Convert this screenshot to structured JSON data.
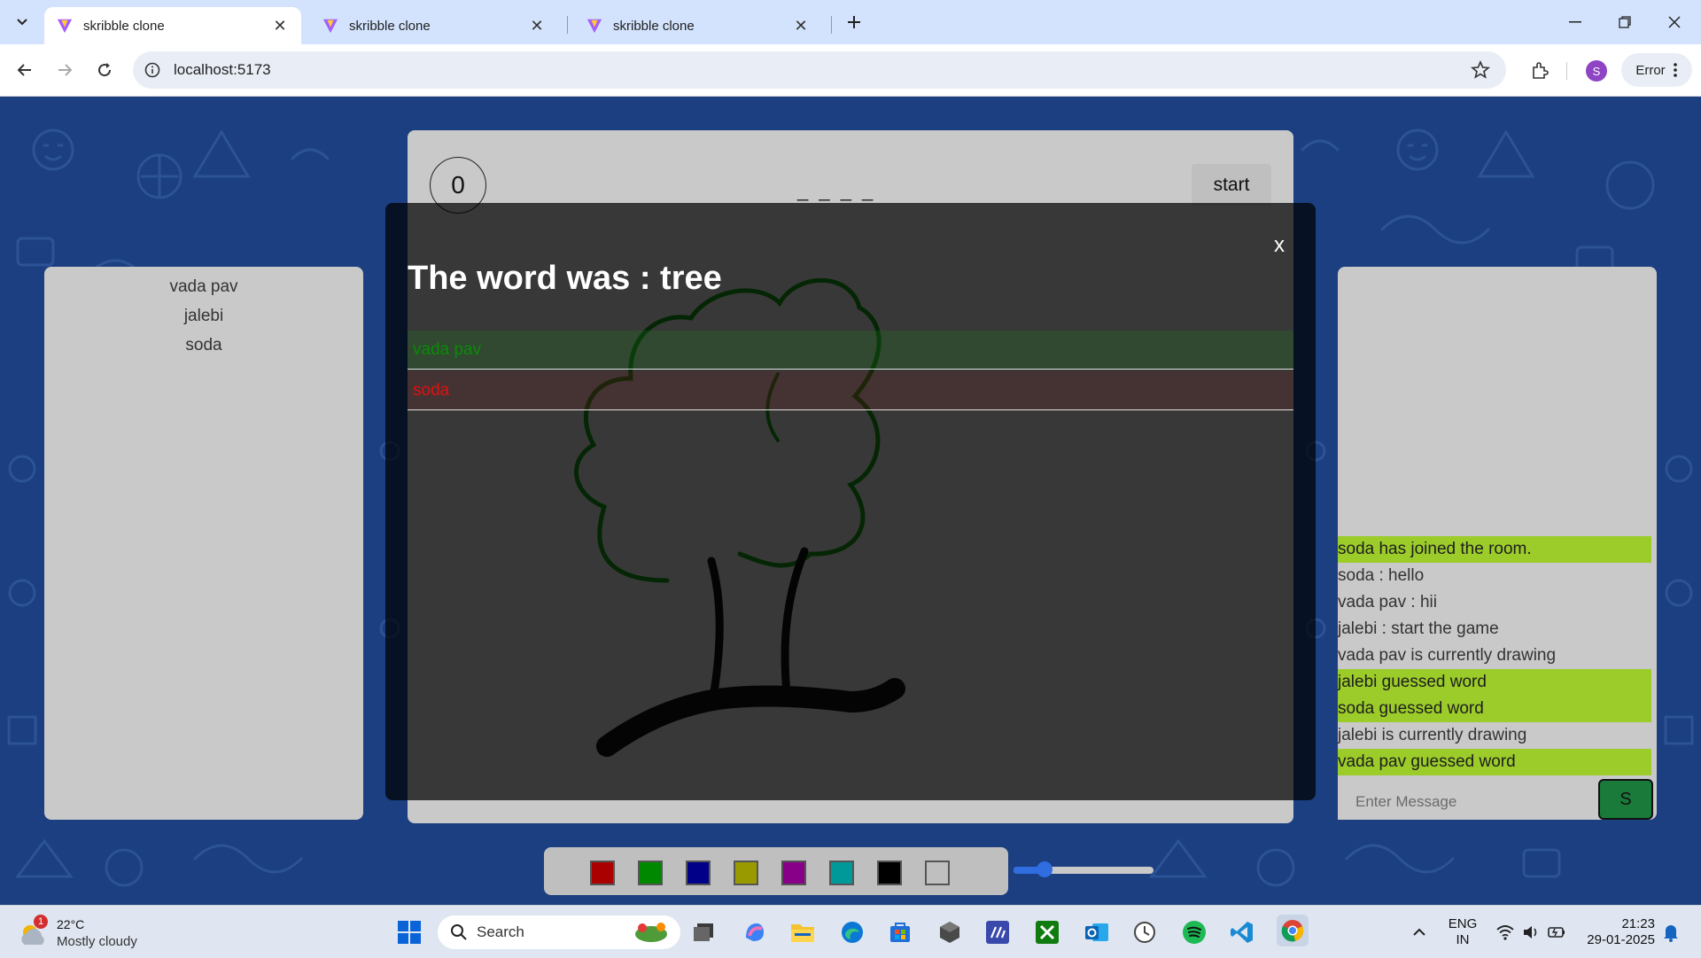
{
  "browser": {
    "tabs": [
      {
        "title": "skribble clone",
        "active": true
      },
      {
        "title": "skribble clone",
        "active": false
      },
      {
        "title": "skribble clone",
        "active": false
      }
    ],
    "url": "localhost:5173",
    "profile_initial": "S",
    "error_label": "Error"
  },
  "game": {
    "timer": "0",
    "word_hint": "_ _ _ _",
    "start_label": "start",
    "players": [
      "vada pav",
      "jalebi",
      "soda"
    ],
    "chat": {
      "messages": [
        {
          "text": "soda has joined the room.",
          "highlight": true
        },
        {
          "text": "soda : hello",
          "highlight": false
        },
        {
          "text": "vada pav : hii",
          "highlight": false
        },
        {
          "text": "jalebi : start the game",
          "highlight": false
        },
        {
          "text": "vada pav is currently drawing",
          "highlight": false
        },
        {
          "text": "jalebi guessed word",
          "highlight": true
        },
        {
          "text": "soda guessed word",
          "highlight": true
        },
        {
          "text": "jalebi is currently drawing",
          "highlight": false
        },
        {
          "text": "vada pav guessed word",
          "highlight": true
        }
      ],
      "input_placeholder": "Enter Message",
      "send_label": "S"
    },
    "palette": [
      "#aa0000",
      "#008800",
      "#000088",
      "#999900",
      "#880088",
      "#009999",
      "#000000",
      "#bfbfbf"
    ],
    "brush_size_fraction": 0.22
  },
  "modal": {
    "title": "The word was : tree",
    "close_label": "x",
    "results": [
      {
        "name": "vada pav",
        "status": "guessed",
        "color": "#0a8a0a"
      },
      {
        "name": "soda",
        "status": "not-guessed",
        "color": "#e01010"
      }
    ]
  },
  "taskbar": {
    "weather": {
      "temp": "22°C",
      "desc": "Mostly cloudy",
      "badge": "1"
    },
    "search_placeholder": "Search",
    "lang": "ENG",
    "region": "IN",
    "time": "21:23",
    "date": "29-01-2025"
  }
}
